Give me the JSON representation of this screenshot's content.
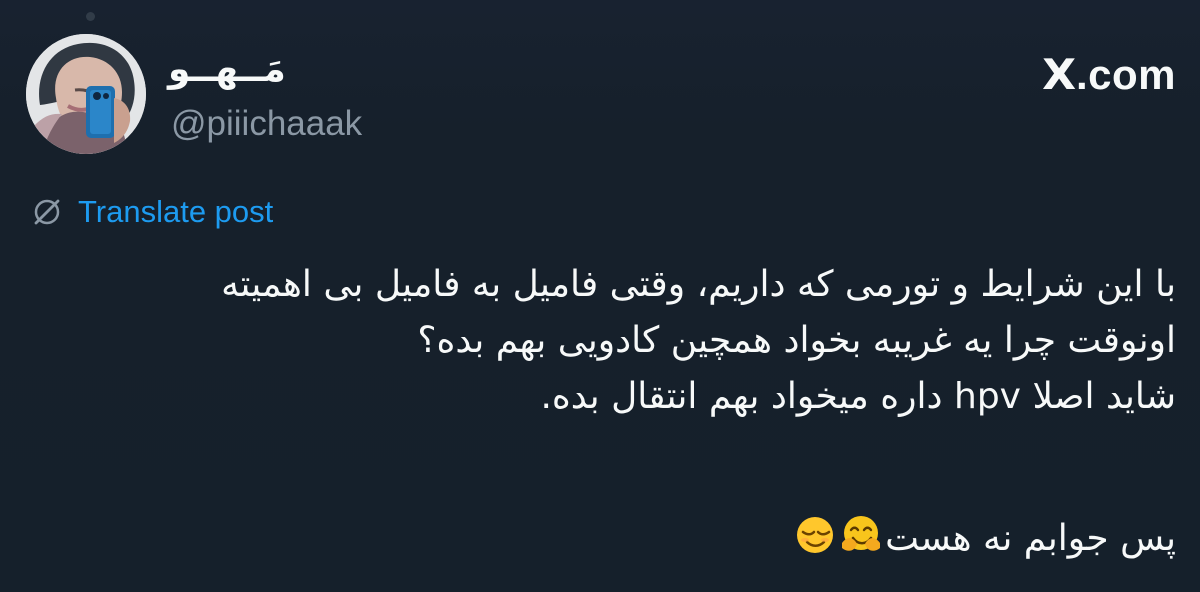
{
  "header": {
    "display_name": "مَــهــو",
    "handle": "@piiichaaak",
    "brand": {
      "logo": "X",
      "suffix": ".com"
    }
  },
  "post": {
    "translate_label": "Translate post",
    "lines": [
      "با این شرایط و تورمی که داریم، وقتی فامیل به فامیل بی اهمیته",
      "اونوقت چرا یه غریبه بخواد همچین کادویی بهم بده؟",
      "شاید اصلا hpv داره میخواد بهم انتقال بده.",
      "پس جوابم نه هست"
    ]
  },
  "icons": {
    "translate": "globe-off-icon",
    "emoji_1": "hugging-face-emoji",
    "emoji_2": "relieved-face-emoji"
  },
  "colors": {
    "background": "#15202b",
    "text": "#f7f9f9",
    "secondary": "#8b98a5",
    "link": "#1d9bf0"
  }
}
